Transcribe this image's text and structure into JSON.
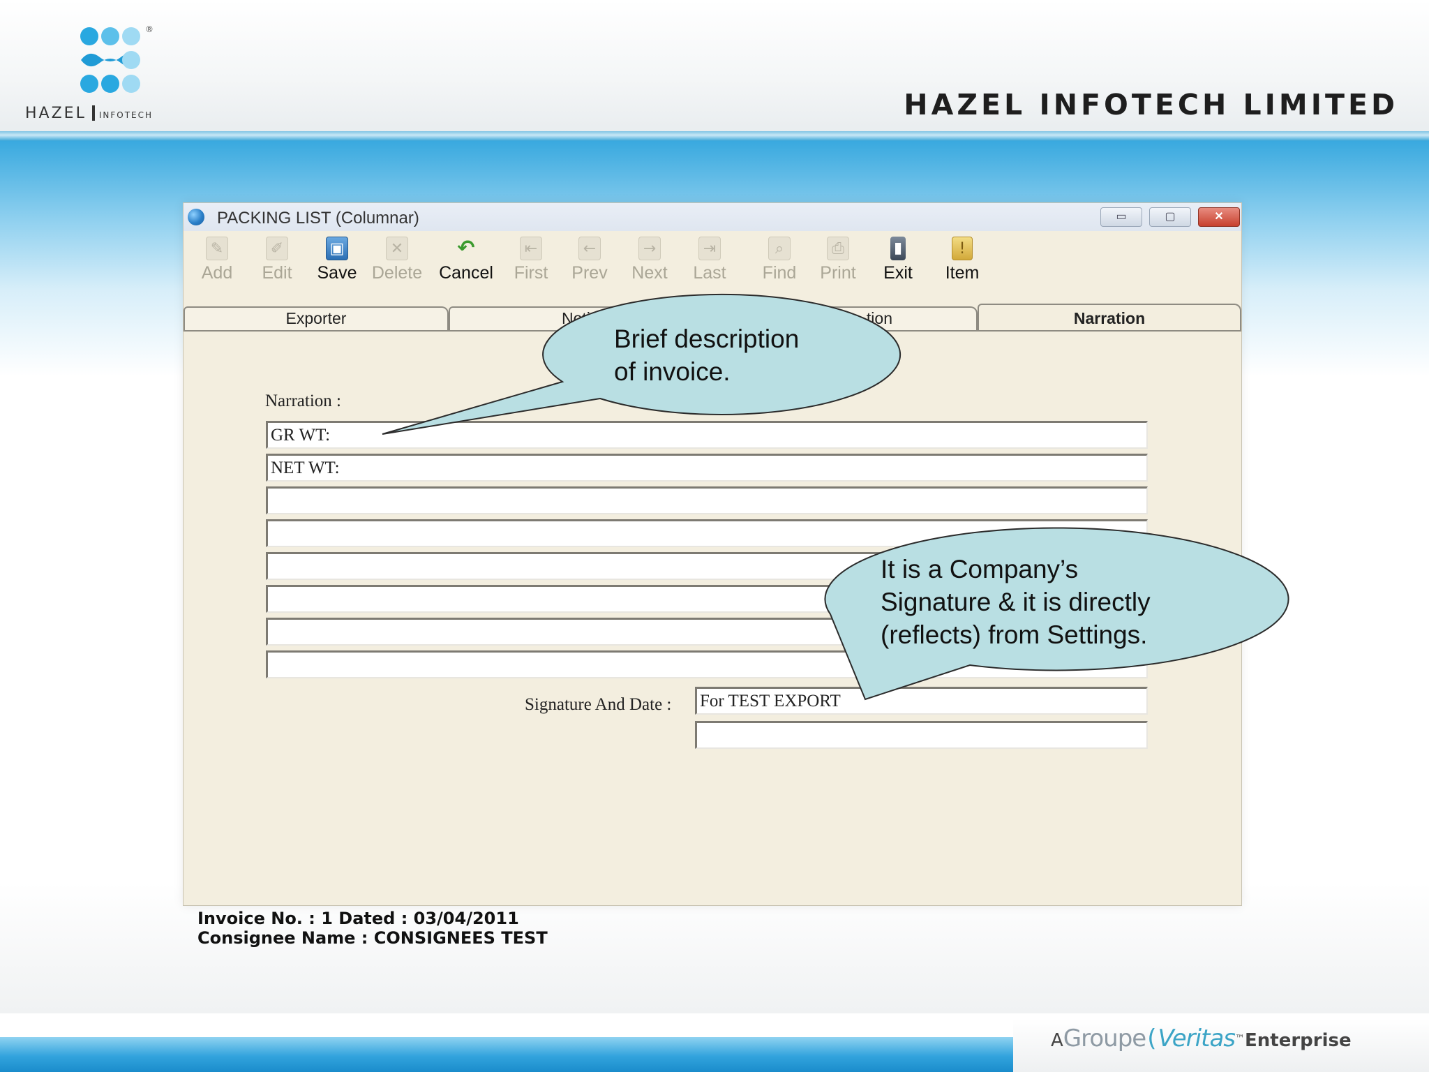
{
  "slide": {
    "logo_text": "HAZEL",
    "logo_subtext": "INFOTECH",
    "logo_registered": "®",
    "company_name": "HAZEL INFOTECH LIMITED",
    "brand": {
      "prefix": "A",
      "groupe": "Groupe",
      "mark": "(",
      "veritas": "Veritas",
      "tm": "™",
      "suffix": "Enterprise"
    }
  },
  "window": {
    "title": "PACKING LIST (Columnar)",
    "controls": {
      "minimize": "▭",
      "maximize": "▢",
      "close": "✕"
    }
  },
  "toolbar": [
    {
      "label": "Add",
      "icon": "add-icon",
      "glyph": "✎",
      "enabled": false
    },
    {
      "label": "Edit",
      "icon": "edit-icon",
      "glyph": "✐",
      "enabled": false
    },
    {
      "label": "Save",
      "icon": "save-icon",
      "glyph": "▣",
      "enabled": true
    },
    {
      "label": "Delete",
      "icon": "delete-icon",
      "glyph": "✕",
      "enabled": false
    },
    {
      "label": "Cancel",
      "icon": "cancel-icon",
      "glyph": "↶",
      "enabled": true
    },
    {
      "label": "First",
      "icon": "first-icon",
      "glyph": "⇤",
      "enabled": false
    },
    {
      "label": "Prev",
      "icon": "prev-icon",
      "glyph": "←",
      "enabled": false
    },
    {
      "label": "Next",
      "icon": "next-icon",
      "glyph": "→",
      "enabled": false
    },
    {
      "label": "Last",
      "icon": "last-icon",
      "glyph": "⇥",
      "enabled": false
    },
    {
      "label": "Find",
      "icon": "find-icon",
      "glyph": "⌕",
      "enabled": false
    },
    {
      "label": "Print",
      "icon": "print-icon",
      "glyph": "⎙",
      "enabled": false
    },
    {
      "label": "Exit",
      "icon": "exit-icon",
      "glyph": "▮",
      "enabled": true
    },
    {
      "label": "Item",
      "icon": "item-icon",
      "glyph": "!",
      "enabled": true
    }
  ],
  "tabs": [
    {
      "label": "Exporter",
      "active": false
    },
    {
      "label": "Noti",
      "active": false
    },
    {
      "label": "tion",
      "active": false
    },
    {
      "label": "Narration",
      "active": true
    }
  ],
  "form": {
    "narration_label": "Narration :",
    "narration_lines": [
      "GR WT:",
      "NET WT:",
      "",
      "",
      "",
      "",
      "",
      ""
    ],
    "signature_label": "Signature And Date :",
    "signature_lines": [
      "For TEST EXPORT",
      ""
    ]
  },
  "status": {
    "invoice_line": "Invoice No. : 1    Dated : 03/04/2011",
    "consignee_line": "Consignee Name : CONSIGNEES TEST"
  },
  "callouts": {
    "narration_note": [
      "Brief description",
      "of invoice."
    ],
    "signature_note": [
      "It is a Company’s",
      "Signature & it is directly",
      "(reflects) from Settings."
    ]
  },
  "colors": {
    "window_bg": "#f3eedf",
    "callout_fill": "#b9dfe3",
    "header_blue": "#3aa6d8",
    "logo_blue": "#29a8e0"
  }
}
